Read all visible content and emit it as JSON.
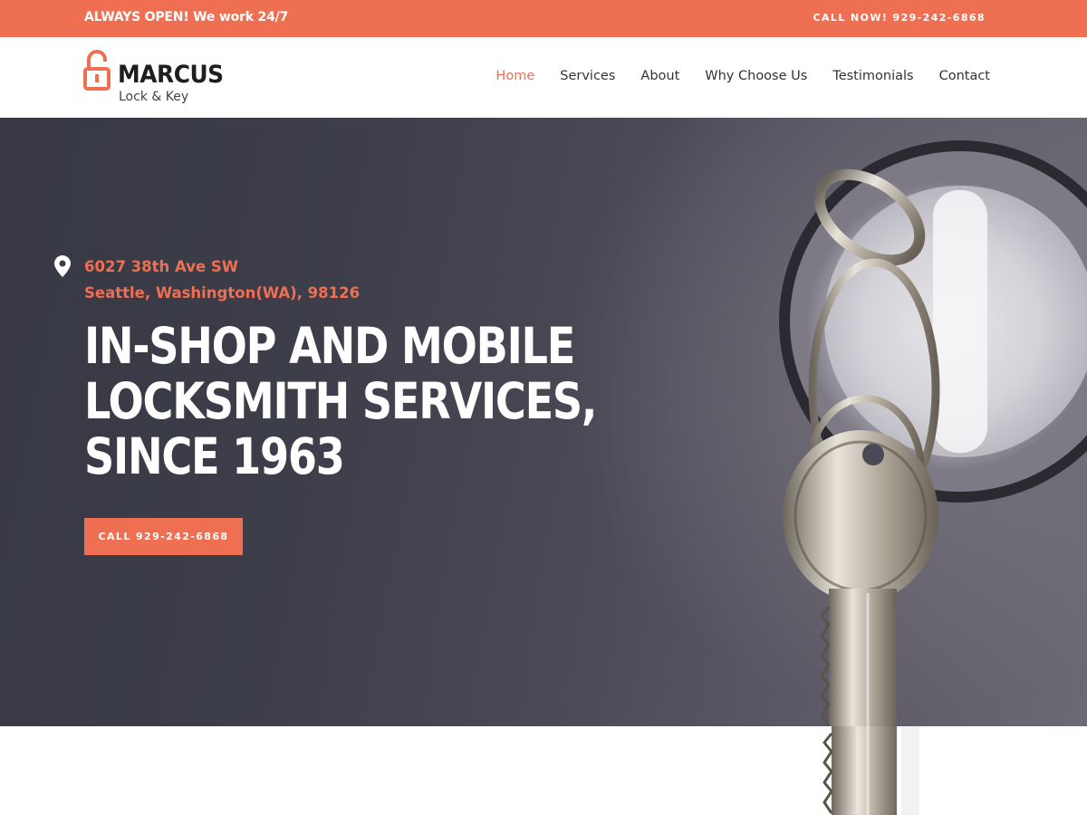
{
  "topbar": {
    "announcement": "ALWAYS OPEN! We work 24/7",
    "call_label": "CALL NOW! 929-242-6868"
  },
  "logo": {
    "icon": "padlock-icon",
    "name": "MARCUS",
    "tagline": "Lock & Key"
  },
  "nav": {
    "items": [
      {
        "label": "Home",
        "active": true
      },
      {
        "label": "Services",
        "active": false
      },
      {
        "label": "About",
        "active": false
      },
      {
        "label": "Why Choose Us",
        "active": false
      },
      {
        "label": "Testimonials",
        "active": false
      },
      {
        "label": "Contact",
        "active": false
      }
    ]
  },
  "hero": {
    "address_icon": "map-pin-icon",
    "address_line1": "6027 38th Ave SW",
    "address_line2": "Seattle, Washington(WA), 98126",
    "headline_lines": [
      "IN-SHOP AND MOBILE",
      "LOCKSMITH SERVICES,",
      "SINCE 1963"
    ],
    "cta_label": "CALL 929-242-6868"
  },
  "colors": {
    "accent": "#ee6f52",
    "hero_bg": "#3d3e4a",
    "text_dark": "#333333",
    "white": "#ffffff"
  }
}
